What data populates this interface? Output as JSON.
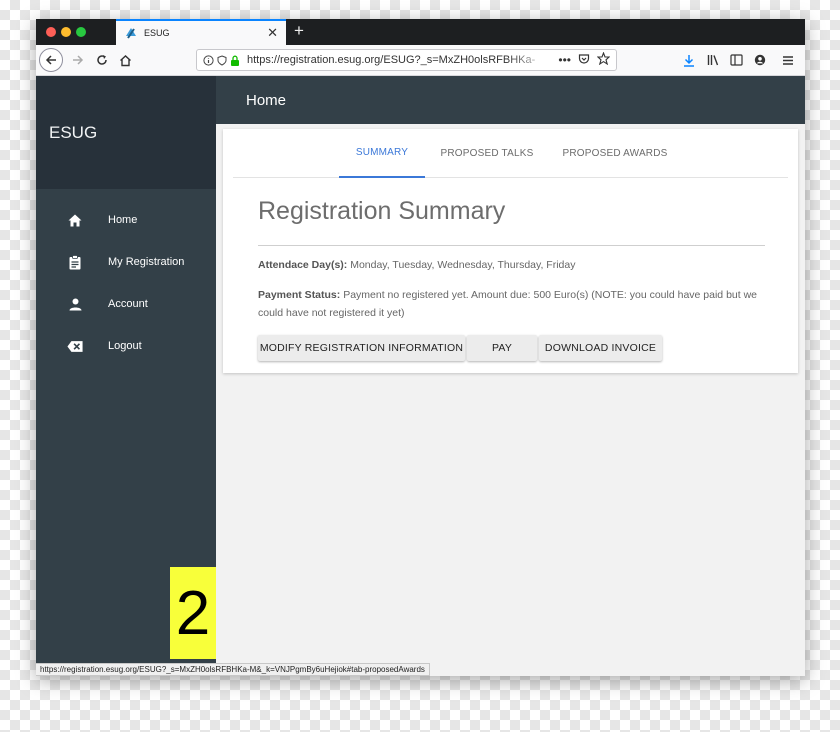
{
  "browser": {
    "tab_title": "ESUG",
    "url": "https://registration.esug.org/ESUG?_s=MxZH0olsRFBHKa-",
    "status_url": "https://registration.esug.org/ESUG?_s=MxZH0olsRFBHKa-M&_k=VNJPgmBy6uHejiok#tab-proposedAwards",
    "actions": {
      "more": "•••"
    }
  },
  "sidebar": {
    "brand": "ESUG",
    "items": [
      {
        "label": "Home",
        "icon": "home-icon"
      },
      {
        "label": "My Registration",
        "icon": "clipboard-icon"
      },
      {
        "label": "Account",
        "icon": "person-icon"
      },
      {
        "label": "Logout",
        "icon": "backspace-icon"
      }
    ]
  },
  "header": {
    "title": "Home"
  },
  "tabs": [
    {
      "label": "SUMMARY",
      "active": true
    },
    {
      "label": "PROPOSED TALKS",
      "active": false
    },
    {
      "label": "PROPOSED AWARDS",
      "active": false
    }
  ],
  "summary": {
    "title": "Registration Summary",
    "attendance_label": "Attendace Day(s):",
    "attendance_value": " Monday, Tuesday, Wednesday, Thursday, Friday",
    "payment_label": "Payment Status:",
    "payment_value": " Payment no registered yet. Amount due: 500 Euro(s) (NOTE: you could have paid but we could have not registered it yet)"
  },
  "buttons": {
    "modify": "MODIFY REGISTRATION INFORMATION",
    "pay": "PAY",
    "download": "DOWNLOAD INVOICE"
  },
  "badge": {
    "number": "2"
  },
  "colors": {
    "sidebar": "#334048",
    "sidebar_brand": "#27313a",
    "accent": "#3b78d8",
    "badge": "#f8ff3a"
  }
}
